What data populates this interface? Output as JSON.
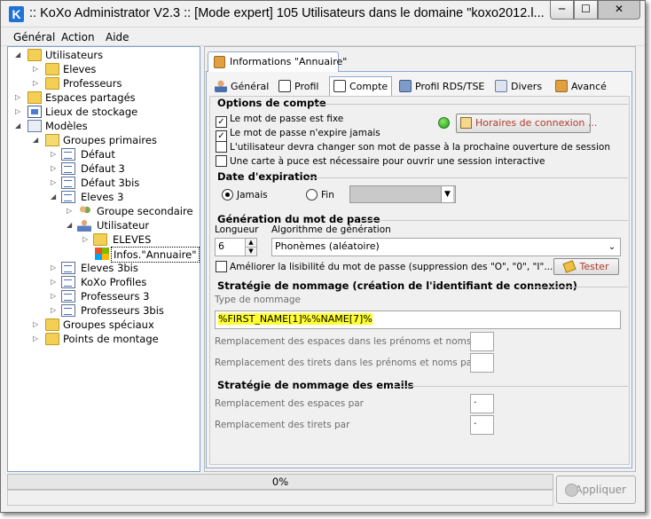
{
  "window": {
    "title": ":: KoXo Administrator V2.3 :: [Mode expert] 105 Utilisateurs dans le domaine \"koxo2012.l...",
    "minimize": "─",
    "maximize": "☐",
    "close": "✕",
    "app_icon": "K"
  },
  "menu": {
    "general": "Général",
    "action": "Action",
    "aide": "Aide"
  },
  "tree": [
    {
      "label": "Utilisateurs",
      "icon": "users-folder-icon"
    },
    {
      "label": "Eleves",
      "icon": "folder-icon"
    },
    {
      "label": "Professeurs",
      "icon": "folder-icon"
    },
    {
      "label": "Espaces partagés",
      "icon": "share-icon"
    },
    {
      "label": "Lieux de stockage",
      "icon": "storage-icon"
    },
    {
      "label": "Modèles",
      "icon": "models-icon"
    },
    {
      "label": "Groupes primaires",
      "icon": "folder-open-icon"
    },
    {
      "label": "Défaut",
      "icon": "page-icon"
    },
    {
      "label": "Défaut 3",
      "icon": "page-icon"
    },
    {
      "label": "Défaut 3bis",
      "icon": "page-icon"
    },
    {
      "label": "Eleves 3",
      "icon": "page-icon"
    },
    {
      "label": "Groupe secondaire",
      "icon": "users-icon"
    },
    {
      "label": "Utilisateur",
      "icon": "user-icon"
    },
    {
      "label": "ELEVES",
      "icon": "folder-icon"
    },
    {
      "label": "Infos.\"Annuaire\"",
      "icon": "windows-icon"
    },
    {
      "label": "Eleves 3bis",
      "icon": "page-icon"
    },
    {
      "label": "KoXo Profiles",
      "icon": "page-icon"
    },
    {
      "label": "Professeurs 3",
      "icon": "page-icon"
    },
    {
      "label": "Professeurs 3bis",
      "icon": "page-icon"
    },
    {
      "label": "Groupes spéciaux",
      "icon": "folder-icon"
    },
    {
      "label": "Points de montage",
      "icon": "folder-icon"
    }
  ],
  "top_tab": "Informations \"Annuaire\"",
  "sub_tabs": [
    "Général",
    "Profil",
    "Compte",
    "Profil RDS/TSE",
    "Divers",
    "Avancé"
  ],
  "account": {
    "options_title": "Options de compte",
    "opt_password_fixed": "Le mot de passe est fixe",
    "opt_password_never_expires": "Le mot de passe n'expire jamais",
    "opt_change_next_logon": "L'utilisateur devra changer son mot de passe à la prochaine ouverture de session",
    "opt_smartcard": "Une carte à puce est nécessaire pour ouvrir une session interactive",
    "schedule_button": "Horaires de connexion ...",
    "expiration_title": "Date d'expiration",
    "never": "Jamais",
    "end": "Fin",
    "pwgen_title": "Génération du mot de passe",
    "length_label": "Longueur",
    "length_value": "6",
    "algo_label": "Algorithme de génération",
    "algo_value": "Phonèmes (aléatoire)",
    "improve_readability": "Améliorer la lisibilité du mot de passe (suppression des \"O\", \"0\", \"I\"...)",
    "test_button": "Tester",
    "naming_title": "Stratégie de nommage (création de l'identifiant de connexion)",
    "naming_type_label": "Type de nommage",
    "naming_value": "%FIRST_NAME[1]%%NAME[7]%",
    "replace_spaces_label": "Remplacement des espaces dans les prénoms et noms par",
    "replace_dashes_label": "Remplacement des tirets dans les prénoms et noms par",
    "email_title": "Stratégie de nommage des emails",
    "email_spaces_label": "Remplacement des espaces  par",
    "email_spaces_value": ".",
    "email_dashes_label": "Remplacement des tirets par",
    "email_dashes_value": "."
  },
  "status": {
    "progress_text": "0%",
    "progress": 0,
    "apply_button": "Appliquer"
  }
}
